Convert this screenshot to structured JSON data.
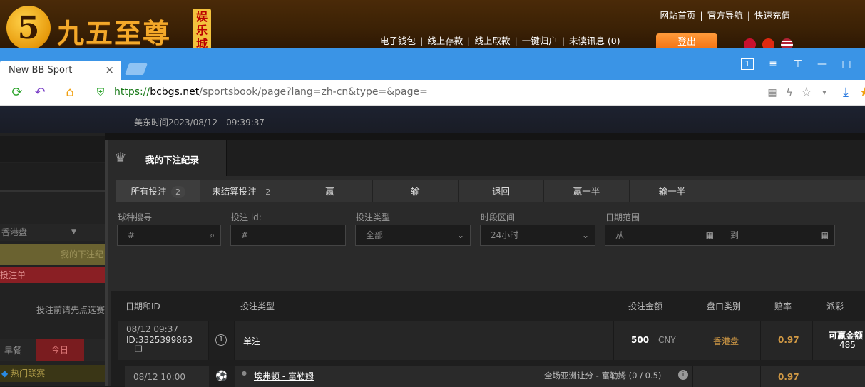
{
  "site": {
    "logo_text": "九五至尊",
    "logo_badge": "娱乐城",
    "top_links": [
      "网站首页",
      "|",
      "官方导航",
      "|",
      "快速充值"
    ],
    "wallet_links": [
      "电子钱包",
      "|",
      "线上存款",
      "|",
      "线上取款",
      "|",
      "一键归户",
      "|",
      "未读讯息 (0)"
    ],
    "logout_label": "登出"
  },
  "browser": {
    "tab_title": "New BB Sport",
    "tab_close": "×",
    "url_scheme": "https://",
    "url_domain": "bcbgs.net",
    "url_path": "/sportsbook/page?lang=zh-cn&type=&page=",
    "window_controls": [
      "1",
      "≡",
      "⊤",
      "—",
      "□"
    ]
  },
  "sportsbook": {
    "us_east_time": "美东时间2023/08/12 - 09:39:37",
    "left_panel": {
      "odds_select": "香港盘",
      "my_bets_link": "我的下注纪",
      "betslip": "投注单",
      "betslip_hint": "投注前请先点选赛",
      "tab_early": "早餐",
      "tab_today": "今日",
      "hot_leagues": "热门联赛"
    },
    "title": "我的下注纪录",
    "filter_tabs": [
      {
        "label": "所有投注",
        "count": "2"
      },
      {
        "label": "未结算投注",
        "count": "2"
      },
      {
        "label": "赢"
      },
      {
        "label": "输"
      },
      {
        "label": "退回"
      },
      {
        "label": "赢一半"
      },
      {
        "label": "输一半"
      }
    ],
    "filters": {
      "sport_search_label": "球种搜寻",
      "sport_search_placeholder": "#",
      "bet_id_label": "投注 id:",
      "bet_id_placeholder": "#",
      "bet_type_label": "投注类型",
      "bet_type_value": "全部",
      "time_range_label": "时段区间",
      "time_range_value": "24小时",
      "date_range_label": "日期范围",
      "date_from": "从",
      "date_to": "到"
    },
    "columns": {
      "date_id": "日期和ID",
      "bet_type": "投注类型",
      "amount": "投注金额",
      "odds_type": "盘口类别",
      "odds": "赔率",
      "payout": "派彩"
    },
    "bet": {
      "datetime": "08/12 09:37",
      "id": "ID:3325399863",
      "order": "1",
      "type": "单注",
      "amount": "500",
      "currency": "CNY",
      "odds_type": "香港盘",
      "odds": "0.97",
      "payout_label": "可赢金额",
      "payout_value": "485"
    },
    "selection": {
      "match_time": "08/12 10:00",
      "match": "埃弗顿 - 富勒姆",
      "market": "全场亚洲让分 - 富勒姆 (0 / 0.5)",
      "odds": "0.97"
    }
  }
}
